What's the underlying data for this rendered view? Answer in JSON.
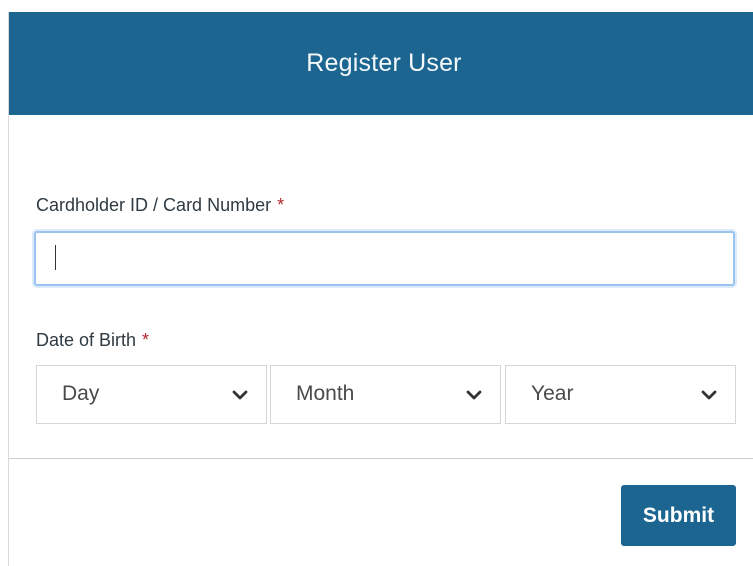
{
  "header": {
    "title": "Register User"
  },
  "form": {
    "cardholder": {
      "label": "Cardholder ID / Card Number",
      "required_mark": "*",
      "value": ""
    },
    "date_of_birth": {
      "label": "Date of Birth",
      "required_mark": "*",
      "day": "Day",
      "month": "Month",
      "year": "Year"
    }
  },
  "actions": {
    "submit_label": "Submit"
  },
  "colors": {
    "brand": "#1c6590",
    "required": "#b3272f",
    "focus": "#9ac3f0"
  }
}
